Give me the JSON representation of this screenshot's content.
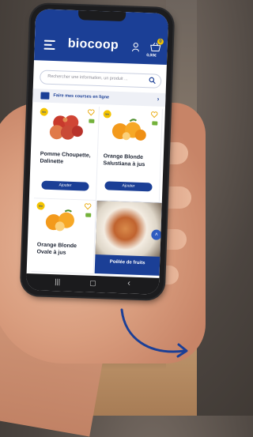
{
  "app": {
    "brand": "biocoop",
    "cart_price": "0,00€",
    "cart_count": "0"
  },
  "search": {
    "placeholder": "Rechercher une information, un produit ..."
  },
  "shop_link": {
    "label": "Faire mes courses en ligne",
    "chevron": "›"
  },
  "products": [
    {
      "name": "Pomme Choupette, Dalinette",
      "badge": "bio",
      "add_label": "Ajouter",
      "image": "apples"
    },
    {
      "name": "Orange Blonde Salustiana à jus",
      "badge": "bio",
      "add_label": "Ajouter",
      "image": "oranges"
    },
    {
      "name": "Orange Blonde Ovale à jus",
      "badge": "bio",
      "image": "oranges"
    }
  ],
  "promo": {
    "label": "Poêlée de fruits"
  },
  "nav": {
    "recent": "|||",
    "home": "▢",
    "back": "‹"
  },
  "icons": [
    "menu-icon",
    "user-icon",
    "cart-icon",
    "search-icon",
    "basket-icon",
    "heart-icon",
    "chevron-up-icon",
    "curved-arrow-icon"
  ],
  "colors": {
    "brand_blue": "#1b3f96",
    "badge_yellow": "#f3c300",
    "leaf_green": "#74b23b"
  }
}
